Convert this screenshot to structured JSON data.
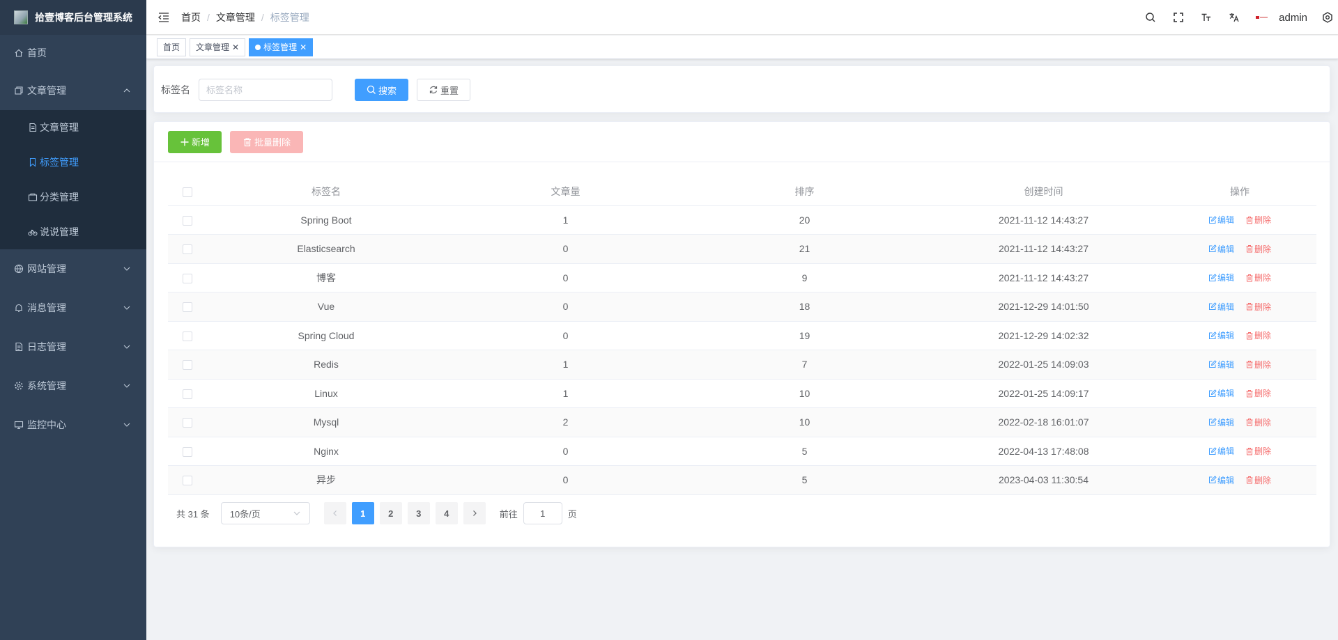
{
  "app": {
    "title": "拾壹博客后台管理系统"
  },
  "sidebar": {
    "items": [
      {
        "label": "首页",
        "icon": "home-icon"
      },
      {
        "label": "文章管理",
        "icon": "documents-icon",
        "expanded": true,
        "children": [
          {
            "label": "文章管理",
            "icon": "document-icon"
          },
          {
            "label": "标签管理",
            "icon": "bookmark-icon",
            "active": true
          },
          {
            "label": "分类管理",
            "icon": "folder-icon"
          },
          {
            "label": "说说管理",
            "icon": "bicycle-icon"
          }
        ]
      },
      {
        "label": "网站管理",
        "icon": "website-icon"
      },
      {
        "label": "消息管理",
        "icon": "bell-icon"
      },
      {
        "label": "日志管理",
        "icon": "log-icon"
      },
      {
        "label": "系统管理",
        "icon": "gear-icon"
      },
      {
        "label": "监控中心",
        "icon": "monitor-icon"
      }
    ]
  },
  "header": {
    "breadcrumb": [
      "首页",
      "文章管理",
      "标签管理"
    ],
    "breadcrumb_sep": "/",
    "user": "admin"
  },
  "tags": [
    {
      "label": "首页",
      "closable": false
    },
    {
      "label": "文章管理",
      "closable": true
    },
    {
      "label": "标签管理",
      "closable": true,
      "active": true
    }
  ],
  "search": {
    "label": "标签名",
    "placeholder": "标签名称",
    "search_button": "搜索",
    "reset_button": "重置"
  },
  "toolbar": {
    "add_button": "新增",
    "batch_delete_button": "批量删除"
  },
  "table": {
    "columns": [
      "标签名",
      "文章量",
      "排序",
      "创建时间",
      "操作"
    ],
    "rows": [
      {
        "name": "Spring Boot",
        "count": "1",
        "sort": "20",
        "created": "2021-11-12 14:43:27"
      },
      {
        "name": "Elasticsearch",
        "count": "0",
        "sort": "21",
        "created": "2021-11-12 14:43:27"
      },
      {
        "name": "博客",
        "count": "0",
        "sort": "9",
        "created": "2021-11-12 14:43:27"
      },
      {
        "name": "Vue",
        "count": "0",
        "sort": "18",
        "created": "2021-12-29 14:01:50"
      },
      {
        "name": "Spring Cloud",
        "count": "0",
        "sort": "19",
        "created": "2021-12-29 14:02:32"
      },
      {
        "name": "Redis",
        "count": "1",
        "sort": "7",
        "created": "2022-01-25 14:09:03"
      },
      {
        "name": "Linux",
        "count": "1",
        "sort": "10",
        "created": "2022-01-25 14:09:17"
      },
      {
        "name": "Mysql",
        "count": "2",
        "sort": "10",
        "created": "2022-02-18 16:01:07"
      },
      {
        "name": "Nginx",
        "count": "0",
        "sort": "5",
        "created": "2022-04-13 17:48:08"
      },
      {
        "name": "异步",
        "count": "0",
        "sort": "5",
        "created": "2023-04-03 11:30:54"
      }
    ],
    "edit_label": "编辑",
    "delete_label": "删除"
  },
  "pagination": {
    "total_text": "共 31 条",
    "page_size": "10条/页",
    "pages": [
      "1",
      "2",
      "3",
      "4"
    ],
    "current": "1",
    "goto_prefix": "前往",
    "goto_value": "1",
    "goto_suffix": "页"
  },
  "colors": {
    "sidebar_bg": "#304156",
    "primary": "#409eff",
    "success": "#67c23a",
    "danger": "#f56c6c"
  }
}
